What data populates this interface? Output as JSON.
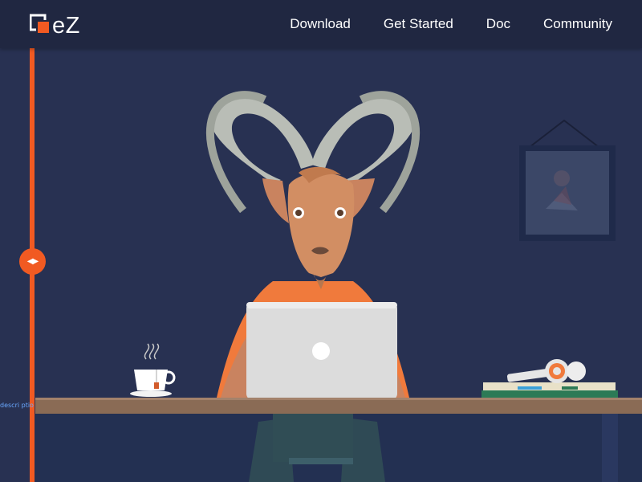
{
  "header": {
    "logo_text": "eZ",
    "nav": [
      {
        "label": "Download"
      },
      {
        "label": "Get Started"
      },
      {
        "label": "Doc"
      },
      {
        "label": "Community"
      }
    ]
  },
  "slider": {
    "handle_glyph": "◀▶",
    "label": "descri ptio"
  },
  "colors": {
    "navbar": "#202741",
    "background": "#283152",
    "accent": "#f15a22",
    "desk": "#8a6b55"
  },
  "icons": [
    "logo-icon",
    "slider-arrows-icon",
    "apple-logo-icon"
  ]
}
